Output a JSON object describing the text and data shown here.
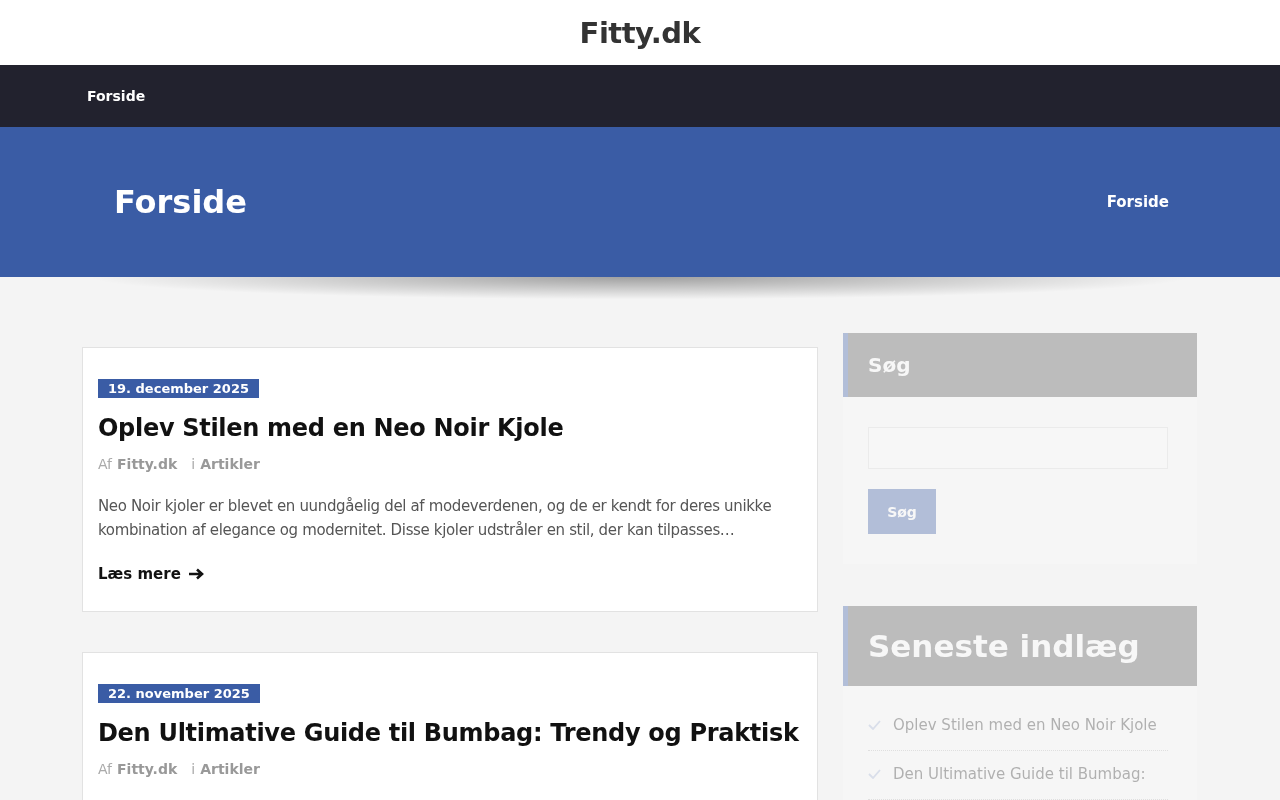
{
  "site_title": "Fitty.dk",
  "nav": [
    {
      "label": "Forside",
      "selected": true
    }
  ],
  "banner": {
    "title": "Forside",
    "breadcrumb": "Forside"
  },
  "posts": [
    {
      "date": "19. december 2025",
      "title": "Oplev Stilen med en Neo Noir Kjole",
      "by_label": "Af",
      "author": "Fitty.dk",
      "in_label": "i",
      "category": "Artikler",
      "excerpt": "Neo Noir kjoler er blevet en uundgåelig del af modeverdenen, og de er kendt for deres unikke kombination af elegance og modernitet. Disse kjoler udstråler en stil, der kan tilpasses…",
      "read_more": "Læs mere"
    },
    {
      "date": "22. november 2025",
      "title": "Den Ultimative Guide til Bumbag: Trendy og Praktisk",
      "by_label": "Af",
      "author": "Fitty.dk",
      "in_label": "i",
      "category": "Artikler"
    }
  ],
  "sidebar": {
    "search": {
      "title": "Søg",
      "button": "Søg"
    },
    "recent": {
      "title": "Seneste indlæg",
      "items": [
        "Oplev Stilen med en Neo Noir Kjole",
        "Den Ultimative Guide til Bumbag:"
      ]
    }
  }
}
